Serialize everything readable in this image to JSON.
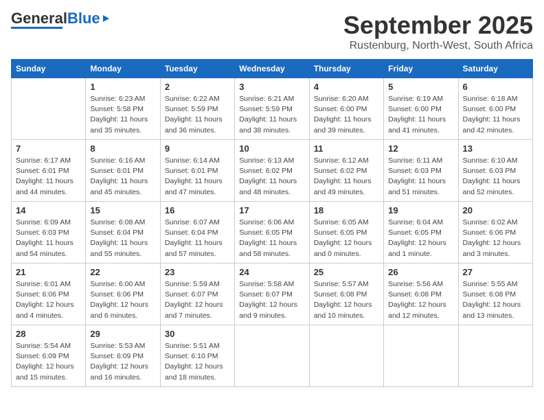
{
  "header": {
    "logo_general": "General",
    "logo_blue": "Blue",
    "month_title": "September 2025",
    "location": "Rustenburg, North-West, South Africa"
  },
  "weekdays": [
    "Sunday",
    "Monday",
    "Tuesday",
    "Wednesday",
    "Thursday",
    "Friday",
    "Saturday"
  ],
  "weeks": [
    [
      {
        "day": "",
        "sunrise": "",
        "sunset": "",
        "daylight": ""
      },
      {
        "day": "1",
        "sunrise": "Sunrise: 6:23 AM",
        "sunset": "Sunset: 5:58 PM",
        "daylight": "Daylight: 11 hours and 35 minutes."
      },
      {
        "day": "2",
        "sunrise": "Sunrise: 6:22 AM",
        "sunset": "Sunset: 5:59 PM",
        "daylight": "Daylight: 11 hours and 36 minutes."
      },
      {
        "day": "3",
        "sunrise": "Sunrise: 6:21 AM",
        "sunset": "Sunset: 5:59 PM",
        "daylight": "Daylight: 11 hours and 38 minutes."
      },
      {
        "day": "4",
        "sunrise": "Sunrise: 6:20 AM",
        "sunset": "Sunset: 6:00 PM",
        "daylight": "Daylight: 11 hours and 39 minutes."
      },
      {
        "day": "5",
        "sunrise": "Sunrise: 6:19 AM",
        "sunset": "Sunset: 6:00 PM",
        "daylight": "Daylight: 11 hours and 41 minutes."
      },
      {
        "day": "6",
        "sunrise": "Sunrise: 6:18 AM",
        "sunset": "Sunset: 6:00 PM",
        "daylight": "Daylight: 11 hours and 42 minutes."
      }
    ],
    [
      {
        "day": "7",
        "sunrise": "Sunrise: 6:17 AM",
        "sunset": "Sunset: 6:01 PM",
        "daylight": "Daylight: 11 hours and 44 minutes."
      },
      {
        "day": "8",
        "sunrise": "Sunrise: 6:16 AM",
        "sunset": "Sunset: 6:01 PM",
        "daylight": "Daylight: 11 hours and 45 minutes."
      },
      {
        "day": "9",
        "sunrise": "Sunrise: 6:14 AM",
        "sunset": "Sunset: 6:01 PM",
        "daylight": "Daylight: 11 hours and 47 minutes."
      },
      {
        "day": "10",
        "sunrise": "Sunrise: 6:13 AM",
        "sunset": "Sunset: 6:02 PM",
        "daylight": "Daylight: 11 hours and 48 minutes."
      },
      {
        "day": "11",
        "sunrise": "Sunrise: 6:12 AM",
        "sunset": "Sunset: 6:02 PM",
        "daylight": "Daylight: 11 hours and 49 minutes."
      },
      {
        "day": "12",
        "sunrise": "Sunrise: 6:11 AM",
        "sunset": "Sunset: 6:03 PM",
        "daylight": "Daylight: 11 hours and 51 minutes."
      },
      {
        "day": "13",
        "sunrise": "Sunrise: 6:10 AM",
        "sunset": "Sunset: 6:03 PM",
        "daylight": "Daylight: 11 hours and 52 minutes."
      }
    ],
    [
      {
        "day": "14",
        "sunrise": "Sunrise: 6:09 AM",
        "sunset": "Sunset: 6:03 PM",
        "daylight": "Daylight: 11 hours and 54 minutes."
      },
      {
        "day": "15",
        "sunrise": "Sunrise: 6:08 AM",
        "sunset": "Sunset: 6:04 PM",
        "daylight": "Daylight: 11 hours and 55 minutes."
      },
      {
        "day": "16",
        "sunrise": "Sunrise: 6:07 AM",
        "sunset": "Sunset: 6:04 PM",
        "daylight": "Daylight: 11 hours and 57 minutes."
      },
      {
        "day": "17",
        "sunrise": "Sunrise: 6:06 AM",
        "sunset": "Sunset: 6:05 PM",
        "daylight": "Daylight: 11 hours and 58 minutes."
      },
      {
        "day": "18",
        "sunrise": "Sunrise: 6:05 AM",
        "sunset": "Sunset: 6:05 PM",
        "daylight": "Daylight: 12 hours and 0 minutes."
      },
      {
        "day": "19",
        "sunrise": "Sunrise: 6:04 AM",
        "sunset": "Sunset: 6:05 PM",
        "daylight": "Daylight: 12 hours and 1 minute."
      },
      {
        "day": "20",
        "sunrise": "Sunrise: 6:02 AM",
        "sunset": "Sunset: 6:06 PM",
        "daylight": "Daylight: 12 hours and 3 minutes."
      }
    ],
    [
      {
        "day": "21",
        "sunrise": "Sunrise: 6:01 AM",
        "sunset": "Sunset: 6:06 PM",
        "daylight": "Daylight: 12 hours and 4 minutes."
      },
      {
        "day": "22",
        "sunrise": "Sunrise: 6:00 AM",
        "sunset": "Sunset: 6:06 PM",
        "daylight": "Daylight: 12 hours and 6 minutes."
      },
      {
        "day": "23",
        "sunrise": "Sunrise: 5:59 AM",
        "sunset": "Sunset: 6:07 PM",
        "daylight": "Daylight: 12 hours and 7 minutes."
      },
      {
        "day": "24",
        "sunrise": "Sunrise: 5:58 AM",
        "sunset": "Sunset: 6:07 PM",
        "daylight": "Daylight: 12 hours and 9 minutes."
      },
      {
        "day": "25",
        "sunrise": "Sunrise: 5:57 AM",
        "sunset": "Sunset: 6:08 PM",
        "daylight": "Daylight: 12 hours and 10 minutes."
      },
      {
        "day": "26",
        "sunrise": "Sunrise: 5:56 AM",
        "sunset": "Sunset: 6:08 PM",
        "daylight": "Daylight: 12 hours and 12 minutes."
      },
      {
        "day": "27",
        "sunrise": "Sunrise: 5:55 AM",
        "sunset": "Sunset: 6:08 PM",
        "daylight": "Daylight: 12 hours and 13 minutes."
      }
    ],
    [
      {
        "day": "28",
        "sunrise": "Sunrise: 5:54 AM",
        "sunset": "Sunset: 6:09 PM",
        "daylight": "Daylight: 12 hours and 15 minutes."
      },
      {
        "day": "29",
        "sunrise": "Sunrise: 5:53 AM",
        "sunset": "Sunset: 6:09 PM",
        "daylight": "Daylight: 12 hours and 16 minutes."
      },
      {
        "day": "30",
        "sunrise": "Sunrise: 5:51 AM",
        "sunset": "Sunset: 6:10 PM",
        "daylight": "Daylight: 12 hours and 18 minutes."
      },
      {
        "day": "",
        "sunrise": "",
        "sunset": "",
        "daylight": ""
      },
      {
        "day": "",
        "sunrise": "",
        "sunset": "",
        "daylight": ""
      },
      {
        "day": "",
        "sunrise": "",
        "sunset": "",
        "daylight": ""
      },
      {
        "day": "",
        "sunrise": "",
        "sunset": "",
        "daylight": ""
      }
    ]
  ]
}
